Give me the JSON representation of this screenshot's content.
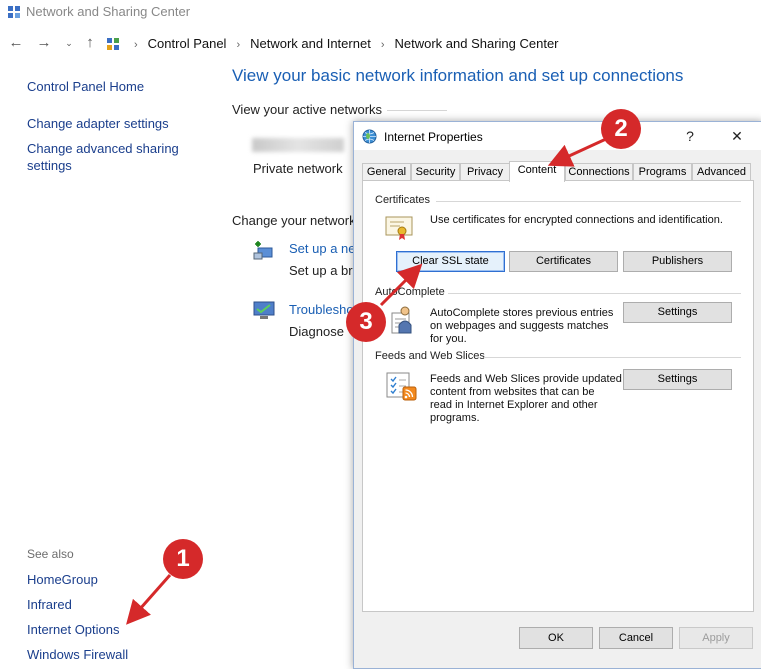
{
  "window": {
    "title": "Network and Sharing Center"
  },
  "address": {
    "crumbs": [
      "Control Panel",
      "Network and Internet",
      "Network and Sharing Center"
    ]
  },
  "left_pane": {
    "links": [
      "Control Panel Home",
      "Change adapter settings",
      "Change advanced sharing",
      "settings"
    ],
    "see_also_heading": "See also",
    "see_also": [
      "HomeGroup",
      "Infrared",
      "Internet Options",
      "Windows Firewall"
    ]
  },
  "main": {
    "heading": "View your basic network information and set up connections",
    "active_networks_label": "View your active networks",
    "network_type": "Private network",
    "change_settings_label": "Change your network",
    "setup_link": "Set up a ne",
    "setup_desc": "Set up a br",
    "troubleshoot_link": "Troublesho",
    "troubleshoot_desc": "Diagnose"
  },
  "dialog": {
    "title": "Internet Properties",
    "help_glyph": "?",
    "close_glyph": "✕",
    "tabs": [
      "General",
      "Security",
      "Privacy",
      "Content",
      "Connections",
      "Programs",
      "Advanced"
    ],
    "active_tab": "Content",
    "certificates": {
      "heading": "Certificates",
      "desc": "Use certificates for encrypted connections and identification.",
      "clear_ssl": "Clear SSL state",
      "certificates_btn": "Certificates",
      "publishers_btn": "Publishers"
    },
    "autocomplete": {
      "heading": "AutoComplete",
      "desc_lines": [
        "AutoComplete stores previous entries",
        "on webpages and suggests matches",
        "for you."
      ],
      "settings_btn": "Settings"
    },
    "feeds": {
      "heading": "Feeds and Web Slices",
      "desc_lines": [
        "Feeds and Web Slices provide updated",
        "content from websites that can be",
        "read in Internet Explorer and other",
        "programs."
      ],
      "settings_btn": "Settings"
    },
    "footer": {
      "ok": "OK",
      "cancel": "Cancel",
      "apply": "Apply"
    }
  },
  "callouts": [
    "1",
    "2",
    "3"
  ],
  "colors": {
    "link": "#1a3e8c",
    "heading": "#1a5fb4",
    "callout": "#d5292a",
    "focus_border": "#2f6fd1"
  }
}
